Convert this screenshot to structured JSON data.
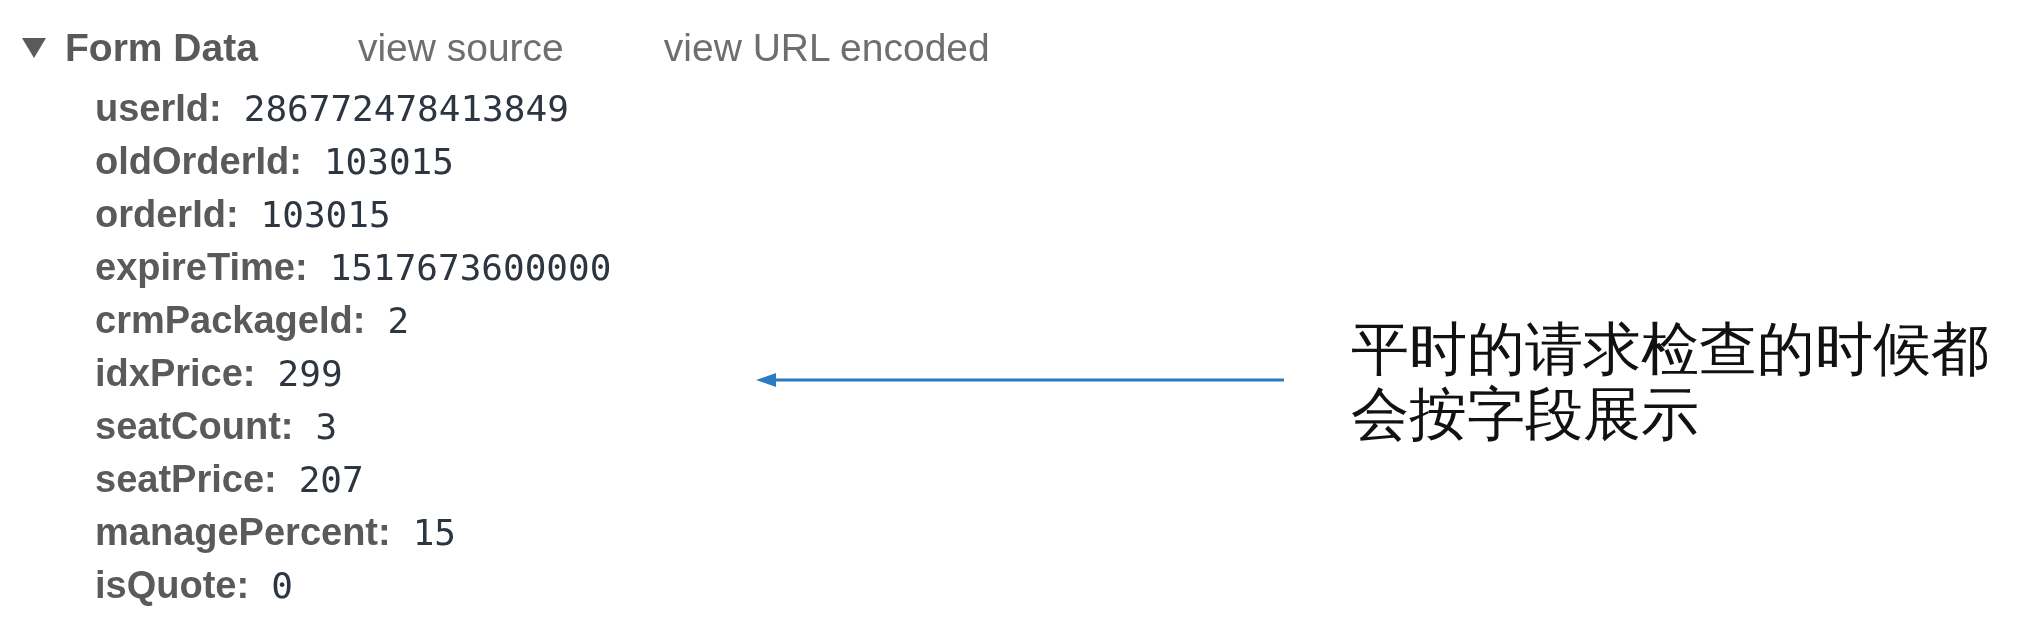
{
  "form_data": {
    "title": "Form Data",
    "expanded": true,
    "links": [
      "view source",
      "view URL encoded"
    ],
    "fields": [
      {
        "name": "userId:",
        "value": "286772478413849"
      },
      {
        "name": "oldOrderId:",
        "value": "103015"
      },
      {
        "name": "orderId:",
        "value": "103015"
      },
      {
        "name": "expireTime:",
        "value": "1517673600000"
      },
      {
        "name": "crmPackageId:",
        "value": "2"
      },
      {
        "name": "idxPrice:",
        "value": "299"
      },
      {
        "name": "seatCount:",
        "value": "3"
      },
      {
        "name": "seatPrice:",
        "value": "207"
      },
      {
        "name": "managePercent:",
        "value": "15"
      },
      {
        "name": "isQuote:",
        "value": "0"
      }
    ]
  },
  "annotation": {
    "text": "平时的请求检查的时候都会按字段展示"
  }
}
